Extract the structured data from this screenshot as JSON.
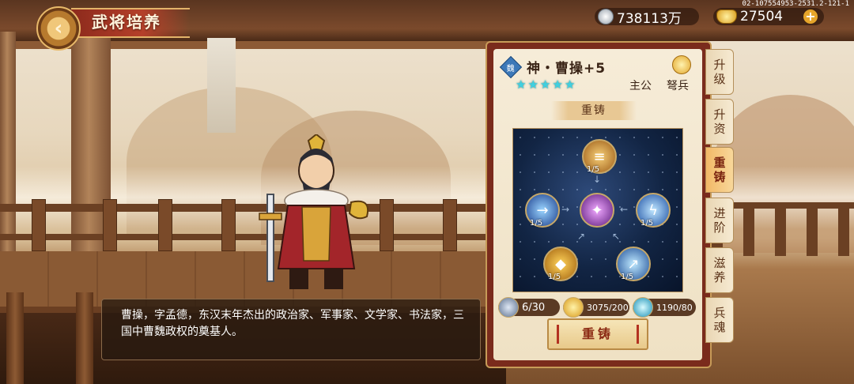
{
  "header": {
    "back_icon": "back-arrow-icon",
    "title": "武将培养",
    "silver_amount": "738113万",
    "gold_amount": "27504",
    "build_id": "02-107554953-2531.2-121-1"
  },
  "hero": {
    "kingdom_badge": "魏",
    "name": "神・曹操+5",
    "star_count": 5,
    "role": "主公",
    "troop_type": "弩兵",
    "bio": "曹操，字孟德，东汉末年杰出的政治家、军事家、文学家、书法家，三国中曹魏政权的奠基人。"
  },
  "reforge": {
    "section_title": "重铸",
    "nodes": [
      {
        "id": "top",
        "level": "1/5",
        "icon": "scroll-skill-icon"
      },
      {
        "id": "left",
        "level": "1/5",
        "icon": "wind-slash-skill-icon"
      },
      {
        "id": "center",
        "level": "",
        "icon": "demon-core-icon"
      },
      {
        "id": "right",
        "level": "1/5",
        "icon": "lightning-skill-icon"
      },
      {
        "id": "bottom_left",
        "level": "1/5",
        "icon": "golden-shield-icon"
      },
      {
        "id": "bottom_right",
        "level": "1/5",
        "icon": "ice-blade-skill-icon"
      }
    ],
    "resources": [
      {
        "icon": "hero-shard-icon",
        "value": "6/30"
      },
      {
        "icon": "gold-ingot-icon",
        "value": "3075/200"
      },
      {
        "icon": "spirit-orb-icon",
        "value": "1190/80"
      }
    ],
    "button_label": "重铸"
  },
  "side_tabs": [
    {
      "label": "升级",
      "active": false
    },
    {
      "label": "升资",
      "active": false
    },
    {
      "label": "重铸",
      "active": true
    },
    {
      "label": "进阶",
      "active": false
    },
    {
      "label": "滋养",
      "active": false
    },
    {
      "label": "兵魂",
      "active": false
    }
  ],
  "colors": {
    "accent_red": "#8c2a1c",
    "panel_parchment": "#f6ecd8",
    "star_cyan": "#3fd0e0",
    "active_tab": "#f2b866"
  }
}
